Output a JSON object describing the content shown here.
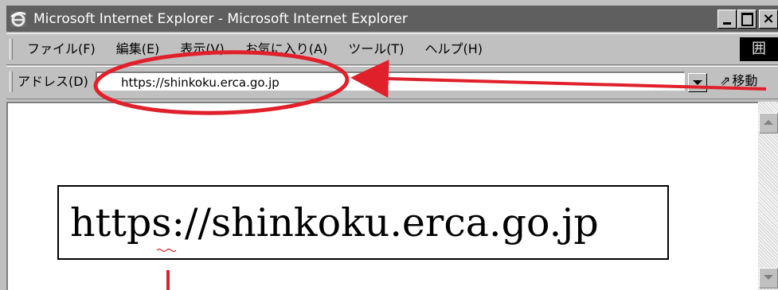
{
  "window": {
    "title": "Microsoft Internet Explorer - Microsoft Internet Explorer",
    "controls": {
      "minimize": "_",
      "maximize": "□",
      "close": "×"
    }
  },
  "menu": {
    "items": [
      "ファイル(F)",
      "編集(E)",
      "表示(V)",
      "お気に入り(A)",
      "ツール(T)",
      "ヘルプ(H)"
    ],
    "logo": "囲"
  },
  "address": {
    "label": "アドレス(D)",
    "url": "https://shinkoku.erca.go.jp",
    "go_label": "移動",
    "go_icon": "⇗"
  },
  "content": {
    "url_text": "https://shinkoku.erca.go.jp"
  },
  "colors": {
    "annotation": "#e0202a",
    "titlebar": "#5f5f5f",
    "chrome": "#c0c0c0"
  },
  "icons": {
    "title": "ie-icon",
    "dropdown": "chevron-down-icon",
    "go": "go-arrow-icon"
  }
}
